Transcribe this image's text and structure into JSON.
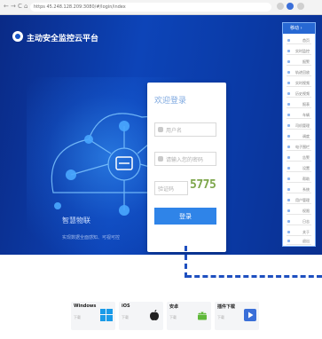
{
  "browser": {
    "nav_glyphs": [
      "←",
      "→",
      "C",
      "⌂"
    ],
    "url": "https  45.248.128.209:3080/#/login/index"
  },
  "header": {
    "brand": "主动安全监控云平台"
  },
  "login": {
    "title": "欢迎登录",
    "username_placeholder": "用户名",
    "password_placeholder": "请输入您的密码",
    "captcha_placeholder": "验证码",
    "captcha_code": "5775",
    "submit": "登录"
  },
  "hero": {
    "tagline": "智慧物联",
    "subline": "实现数据全面感知、可视可控"
  },
  "mobile_menu": {
    "header": "移动 ›",
    "items": [
      "首页",
      "实时监控",
      "报警",
      "轨迹回放",
      "实时视频",
      "历史视频",
      "报表",
      "车辆",
      "司机管理",
      "调度",
      "电子围栏",
      "告警",
      "设置",
      "帮助",
      "系统",
      "用户管理",
      "权限",
      "日志",
      "关于",
      "退出"
    ]
  },
  "downloads": [
    {
      "title": "Windows",
      "label": "下载",
      "icon": "windows-icon"
    },
    {
      "title": "iOS",
      "label": "下载",
      "icon": "apple-icon"
    },
    {
      "title": "安卓",
      "label": "下载",
      "icon": "android-icon"
    },
    {
      "title": "插件下载",
      "label": "下载",
      "icon": "play-icon"
    }
  ],
  "colors": {
    "hero_dark": "#0a2a86",
    "hero_mid": "#0d44b8",
    "accent": "#2f84e8",
    "dashed": "#1e4fbf",
    "captcha_green": "#7da64b"
  }
}
